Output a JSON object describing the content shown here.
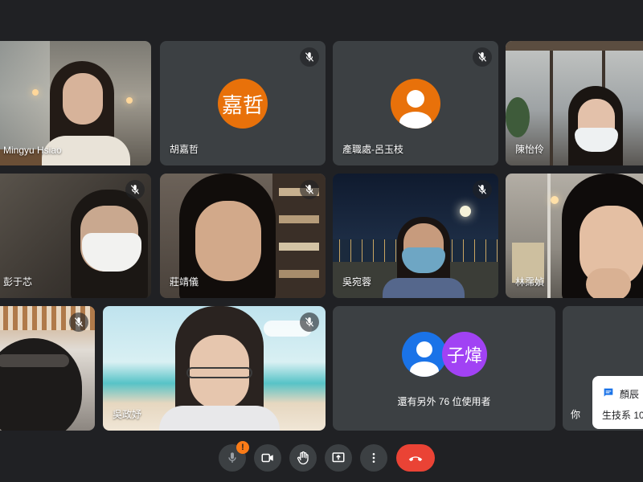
{
  "participants": [
    {
      "name": "Mingyu Hsiao"
    },
    {
      "name": "胡嘉哲",
      "avatar_text": "嘉哲"
    },
    {
      "name": "產職處-呂玉枝"
    },
    {
      "name": "陳怡伶"
    },
    {
      "name": "彭于芯"
    },
    {
      "name": "莊靖儀"
    },
    {
      "name": "吳宛蓉"
    },
    {
      "name": "林霈媜"
    },
    {
      "name": ""
    },
    {
      "name": "吳政妤"
    }
  ],
  "others": {
    "avatar_text": "子煒",
    "label": "還有另外 76 位使用者"
  },
  "self_tile": {
    "label": "你"
  },
  "chat_toast": {
    "sender": "顏辰",
    "message": "生技系 10"
  },
  "toolbar": {
    "mic_warning": "!"
  },
  "colors": {
    "background": "#202124",
    "tile": "#3c4043",
    "avatar_orange": "#e8710a",
    "avatar_blue": "#1a73e8",
    "avatar_purple": "#a142f4",
    "end_call": "#ea4335",
    "warning": "#fa7b17"
  },
  "icons": [
    "mic-off-icon",
    "mic-icon",
    "video-camera-icon",
    "raise-hand-icon",
    "present-screen-icon",
    "more-options-icon",
    "end-call-icon",
    "person-icon",
    "chat-icon"
  ]
}
